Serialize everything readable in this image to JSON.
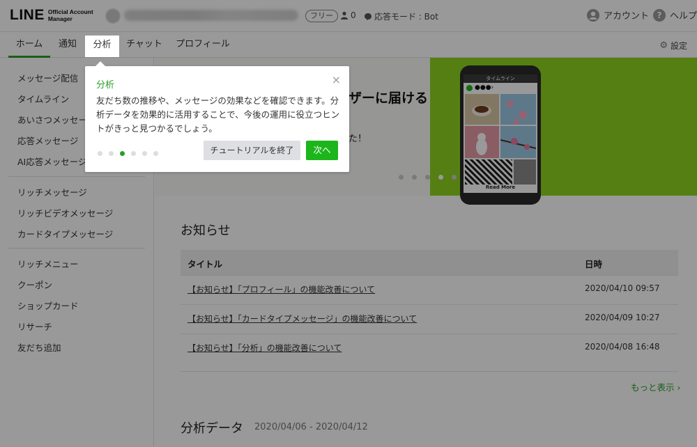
{
  "header": {
    "logo_main": "LINE",
    "logo_sub_line1": "Official Account",
    "logo_sub_line2": "Manager",
    "plan_badge": "フリー",
    "friends_count": "0",
    "response_mode": "応答モード : Bot",
    "account_label": "アカウント",
    "help_label": "ヘルプ"
  },
  "nav": {
    "tabs": [
      {
        "label": "ホーム"
      },
      {
        "label": "通知"
      },
      {
        "label": "分析"
      },
      {
        "label": "チャット"
      },
      {
        "label": "プロフィール"
      }
    ],
    "settings_label": "設定"
  },
  "sidebar": {
    "items": [
      {
        "label": "メッセージ配信"
      },
      {
        "label": "タイムライン"
      },
      {
        "label": "あいさつメッセージ"
      },
      {
        "label": "応答メッセージ"
      },
      {
        "label": "AI応答メッセージ"
      },
      {
        "label": "リッチメッセージ"
      },
      {
        "label": "リッチビデオメッセージ"
      },
      {
        "label": "カードタイプメッセージ"
      },
      {
        "label": "リッチメニュー"
      },
      {
        "label": "クーポン"
      },
      {
        "label": "ショップカード"
      },
      {
        "label": "リサーチ"
      },
      {
        "label": "友だち追加"
      }
    ]
  },
  "banner": {
    "headline": "ザーに届ける",
    "subtext": "た！",
    "phone_bar": "タイムライン",
    "phone_read_more": "Read More"
  },
  "notices": {
    "title": "お知らせ",
    "col_title": "タイトル",
    "col_date": "日時",
    "rows": [
      {
        "title": "【お知らせ】「プロフィール」の機能改善について",
        "date": "2020/04/10 09:57"
      },
      {
        "title": "【お知らせ】「カードタイプメッセージ」の機能改善について",
        "date": "2020/04/09 10:27"
      },
      {
        "title": "【お知らせ】「分析」の機能改善について",
        "date": "2020/04/08 16:48"
      }
    ],
    "more_label": "もっと表示"
  },
  "analytics": {
    "title": "分析データ",
    "range": "2020/04/06 - 2020/04/12"
  },
  "tutorial": {
    "title": "分析",
    "body": "友だち数の推移や、メッセージの効果などを確認できます。分析データを効果的に活用することで、今後の運用に役立つヒントがきっと見つかるでしょう。",
    "end_label": "チュートリアルを終了",
    "next_label": "次へ",
    "step_current": 3,
    "step_total": 6
  },
  "colors": {
    "accent": "#2a9d2a",
    "button_green": "#1cb51c",
    "banner_green": "#8ed41f"
  }
}
